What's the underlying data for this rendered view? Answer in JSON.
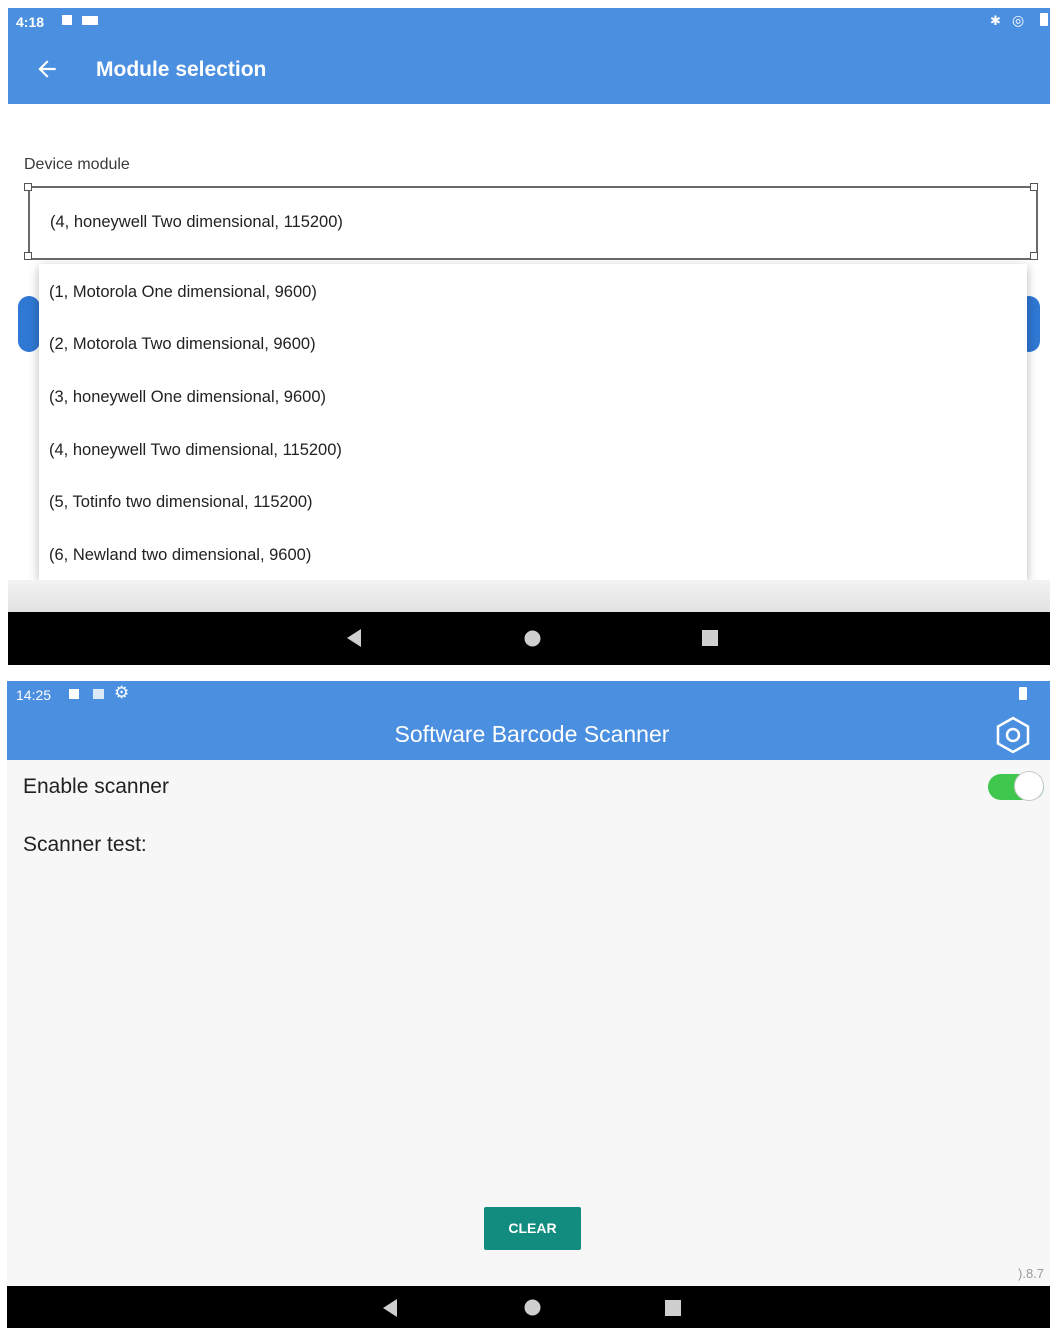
{
  "screen1": {
    "status_time": "4:18",
    "title": "Module selection",
    "field_label": "Device module",
    "selected_value": "(4, honeywell Two dimensional, 115200)",
    "options": [
      "(1, Motorola One dimensional, 9600)",
      "(2, Motorola Two dimensional, 9600)",
      "(3, honeywell One dimensional, 9600)",
      "(4, honeywell Two dimensional, 115200)",
      "(5, Totinfo two dimensional, 115200)",
      "(6, Newland two dimensional, 9600)"
    ]
  },
  "screen2": {
    "status_time": "14:25",
    "title": "Software Barcode Scanner",
    "enable_label": "Enable scanner",
    "enable_on": true,
    "test_label": "Scanner test:",
    "clear_label": "CLEAR",
    "version": ").8.7"
  },
  "colors": {
    "app_bar": "#4a8fe0",
    "toggle_on": "#3ec74c",
    "clear_button": "#128c7e",
    "nav_bar": "#000000"
  },
  "icons": {
    "back": "arrow-left-icon",
    "settings": "gear-icon",
    "nav_back": "triangle-back-icon",
    "nav_home": "circle-home-icon",
    "nav_recents": "square-recents-icon"
  }
}
